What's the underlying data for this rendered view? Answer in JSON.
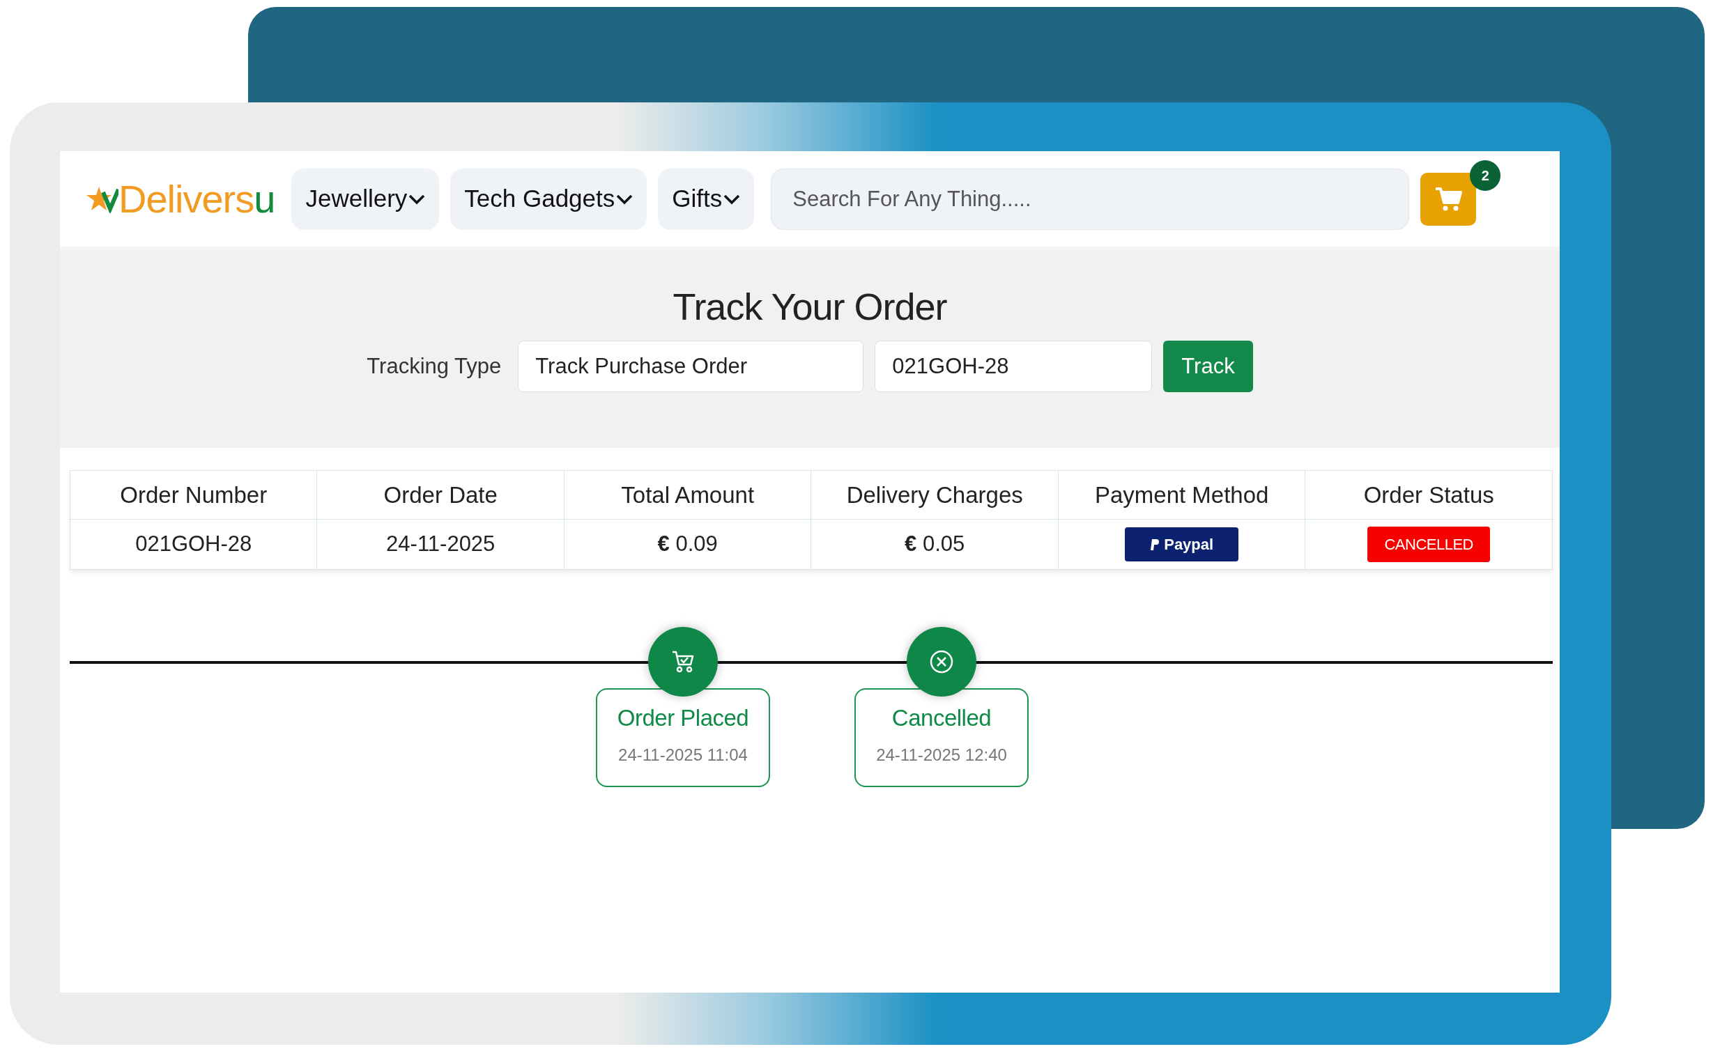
{
  "logo": [
    {
      "text": "Delivers",
      "color": "#f39a21"
    },
    {
      "text": "u",
      "color": "#138a3e"
    }
  ],
  "nav_menus": [
    {
      "label": "Jewellery"
    },
    {
      "label": "Tech Gadgets"
    },
    {
      "label": "Gifts"
    }
  ],
  "search": {
    "placeholder": "Search For Any Thing....."
  },
  "cart": {
    "count": "2"
  },
  "title": "Track Your Order",
  "tracking_form": {
    "label": "Tracking Type",
    "type_value": "Track Purchase Order",
    "number_value": "021GOH-28",
    "button": "Track"
  },
  "table": {
    "columns": [
      "Order Number",
      "Order Date",
      "Total Amount",
      "Delivery Charges",
      "Payment Method",
      "Order Status"
    ],
    "rows": [
      [
        {
          "kind": "text",
          "text": "021GOH-28"
        },
        {
          "kind": "text",
          "text": "24-11-2025"
        },
        {
          "kind": "text",
          "text": "**€** 0.09"
        },
        {
          "kind": "text",
          "text": "**€** 0.05"
        },
        {
          "kind": "payment",
          "text": "Paypal"
        },
        {
          "kind": "status",
          "text": "CANCELLED"
        }
      ]
    ]
  },
  "timeline": [
    {
      "kind": "cart",
      "title": "Order Placed",
      "time": "24-11-2025 11:04"
    },
    {
      "kind": "cancel",
      "title": "Cancelled",
      "time": "24-11-2025 12:40"
    }
  ]
}
